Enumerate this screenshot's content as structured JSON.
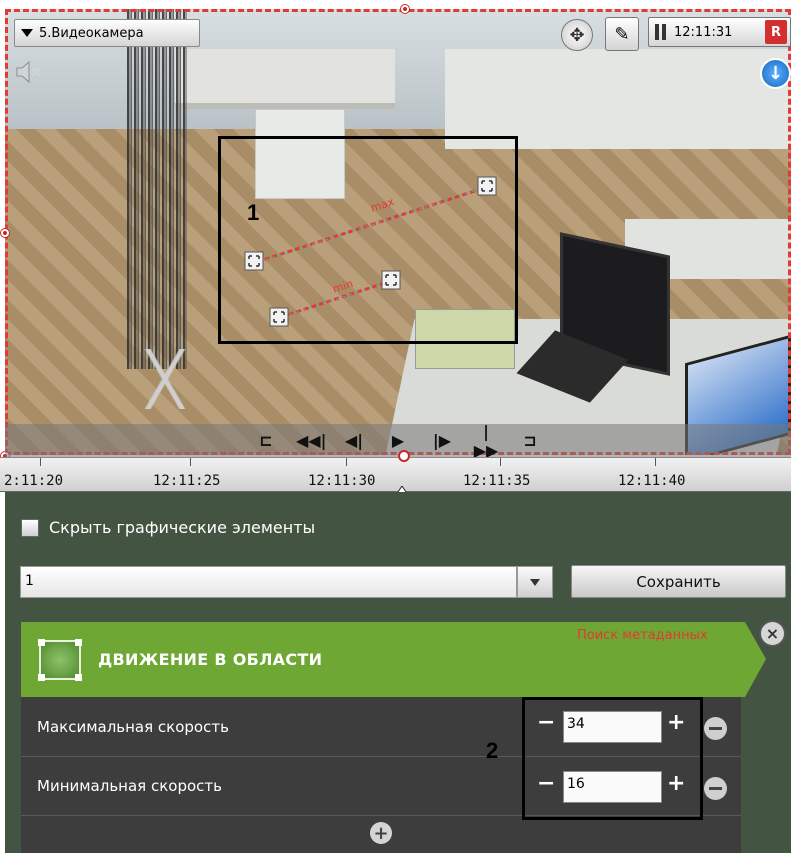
{
  "camera": {
    "selector_label": "5.Видеокамера"
  },
  "toolbar": {
    "time": "12:11:31",
    "record_badge": "R",
    "mute_icon": "speaker-muted-icon",
    "move_icon": "move-arrows-icon",
    "edit_icon": "edit-note-icon",
    "download_icon": "download-arrow-icon"
  },
  "annotations": {
    "callout_1": "1",
    "callout_2": "2",
    "max_marker_label": "max",
    "min_marker_label": "min"
  },
  "playback": {
    "buttons": [
      "go-to-start",
      "step-back-fast",
      "step-back",
      "play",
      "step-forward",
      "step-forward-fast",
      "go-to-end"
    ]
  },
  "timeline": {
    "ticks": [
      "2:11:20",
      "12:11:25",
      "12:11:30",
      "12:11:35",
      "12:11:40"
    ]
  },
  "panel": {
    "hide_graphics_label": "Скрыть графические элементы",
    "zone_value": "1",
    "save_label": "Сохранить",
    "metadata_search": "Поиск метаданных",
    "rule_title": "ДВИЖЕНИЕ В ОБЛАСТИ",
    "params": [
      {
        "label": "Максимальная скорость",
        "value": "34"
      },
      {
        "label": "Минимальная скорость",
        "value": "16"
      }
    ]
  },
  "colors": {
    "accent_green": "#6ea733",
    "panel_bg": "#435442",
    "card_bg": "#3d3d3d",
    "frame_red": "#e53935"
  }
}
